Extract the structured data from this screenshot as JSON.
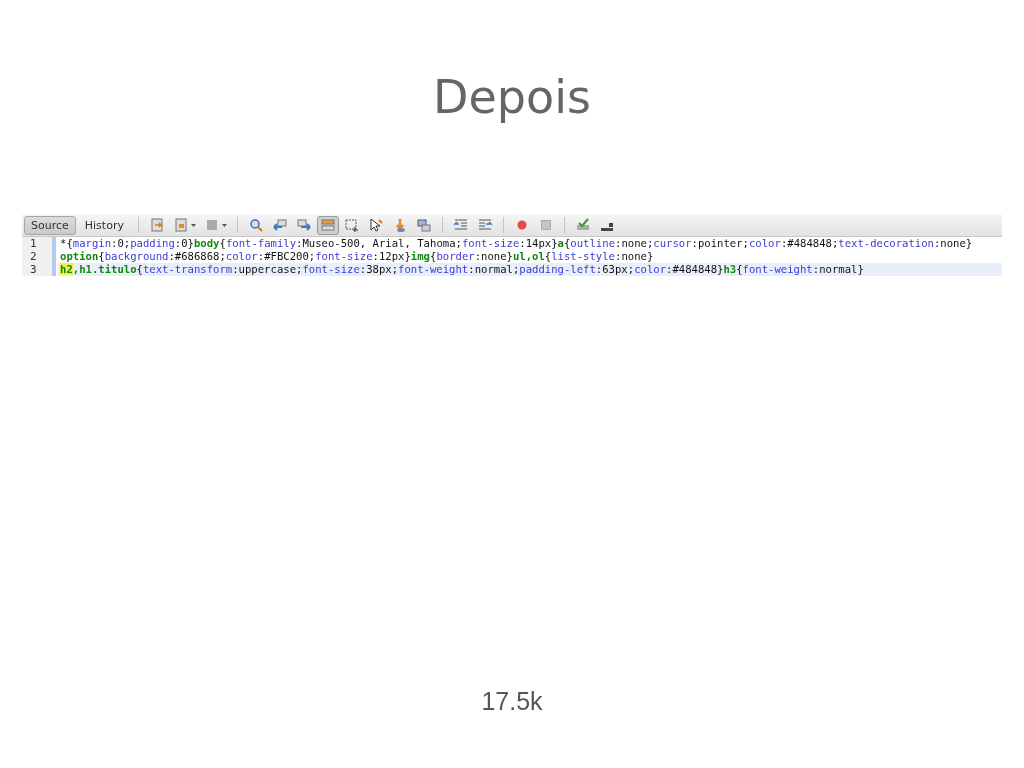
{
  "slide": {
    "title": "Depois",
    "footer": "17.5k"
  },
  "editor": {
    "tabs": [
      {
        "label": "Source",
        "selected": true
      },
      {
        "label": "History",
        "selected": false
      }
    ],
    "toolbar_buttons": [
      {
        "on": false
      },
      {
        "on": false
      },
      {
        "on": false
      },
      {
        "on": false
      },
      {
        "on": false
      },
      {
        "on": false
      },
      {
        "on": true
      },
      {
        "on": false
      },
      {
        "on": false
      },
      {
        "on": false
      },
      {
        "on": false
      },
      {
        "on": false
      },
      {
        "on": false
      },
      {
        "on": false
      },
      {
        "on": false
      },
      {
        "on": false
      },
      {
        "on": false
      }
    ],
    "lines": [
      {
        "number": "1",
        "current": false,
        "tokens": [
          {
            "kind": "text",
            "text": "*{"
          },
          {
            "kind": "prop",
            "text": "margin"
          },
          {
            "kind": "text",
            "text": ":0;"
          },
          {
            "kind": "prop",
            "text": "padding"
          },
          {
            "kind": "text",
            "text": ":0}"
          },
          {
            "kind": "sel",
            "text": "body"
          },
          {
            "kind": "text",
            "text": "{"
          },
          {
            "kind": "prop",
            "text": "font-family"
          },
          {
            "kind": "text",
            "text": ":Museo-500, Arial, Tahoma;"
          },
          {
            "kind": "prop",
            "text": "font-size"
          },
          {
            "kind": "text",
            "text": ":14px}"
          },
          {
            "kind": "sel",
            "text": "a"
          },
          {
            "kind": "text",
            "text": "{"
          },
          {
            "kind": "prop",
            "text": "outline"
          },
          {
            "kind": "text",
            "text": ":none;"
          },
          {
            "kind": "prop",
            "text": "cursor"
          },
          {
            "kind": "text",
            "text": ":pointer;"
          },
          {
            "kind": "prop",
            "text": "color"
          },
          {
            "kind": "text",
            "text": ":#484848;"
          },
          {
            "kind": "prop",
            "text": "text-decoration"
          },
          {
            "kind": "text",
            "text": ":none}"
          }
        ]
      },
      {
        "number": "2",
        "current": false,
        "tokens": [
          {
            "kind": "sel",
            "text": "option"
          },
          {
            "kind": "text",
            "text": "{"
          },
          {
            "kind": "prop",
            "text": "background"
          },
          {
            "kind": "text",
            "text": ":#686868;"
          },
          {
            "kind": "prop",
            "text": "color"
          },
          {
            "kind": "text",
            "text": ":#FBC200;"
          },
          {
            "kind": "prop",
            "text": "font-size"
          },
          {
            "kind": "text",
            "text": ":12px}"
          },
          {
            "kind": "sel",
            "text": "img"
          },
          {
            "kind": "text",
            "text": "{"
          },
          {
            "kind": "prop",
            "text": "border"
          },
          {
            "kind": "text",
            "text": ":none}"
          },
          {
            "kind": "sel",
            "text": "ul,ol"
          },
          {
            "kind": "text",
            "text": "{"
          },
          {
            "kind": "prop",
            "text": "list-style"
          },
          {
            "kind": "text",
            "text": ":none}"
          }
        ]
      },
      {
        "number": "3",
        "current": true,
        "tokens": [
          {
            "kind": "match",
            "text": "h2"
          },
          {
            "kind": "sel",
            "text": ",h1.titulo"
          },
          {
            "kind": "text",
            "text": "{"
          },
          {
            "kind": "prop",
            "text": "text-transform"
          },
          {
            "kind": "text",
            "text": ":uppercase;"
          },
          {
            "kind": "prop",
            "text": "font-size"
          },
          {
            "kind": "text",
            "text": ":38px;"
          },
          {
            "kind": "prop",
            "text": "font-weight"
          },
          {
            "kind": "text",
            "text": ":normal;"
          },
          {
            "kind": "prop",
            "text": "padding-left"
          },
          {
            "kind": "text",
            "text": ":63px;"
          },
          {
            "kind": "prop",
            "text": "color"
          },
          {
            "kind": "text",
            "text": ":#484848}"
          },
          {
            "kind": "sel",
            "text": "h3"
          },
          {
            "kind": "text",
            "text": "{"
          },
          {
            "kind": "prop",
            "text": "font-weight"
          },
          {
            "kind": "text",
            "text": ":normal}"
          }
        ]
      }
    ]
  }
}
